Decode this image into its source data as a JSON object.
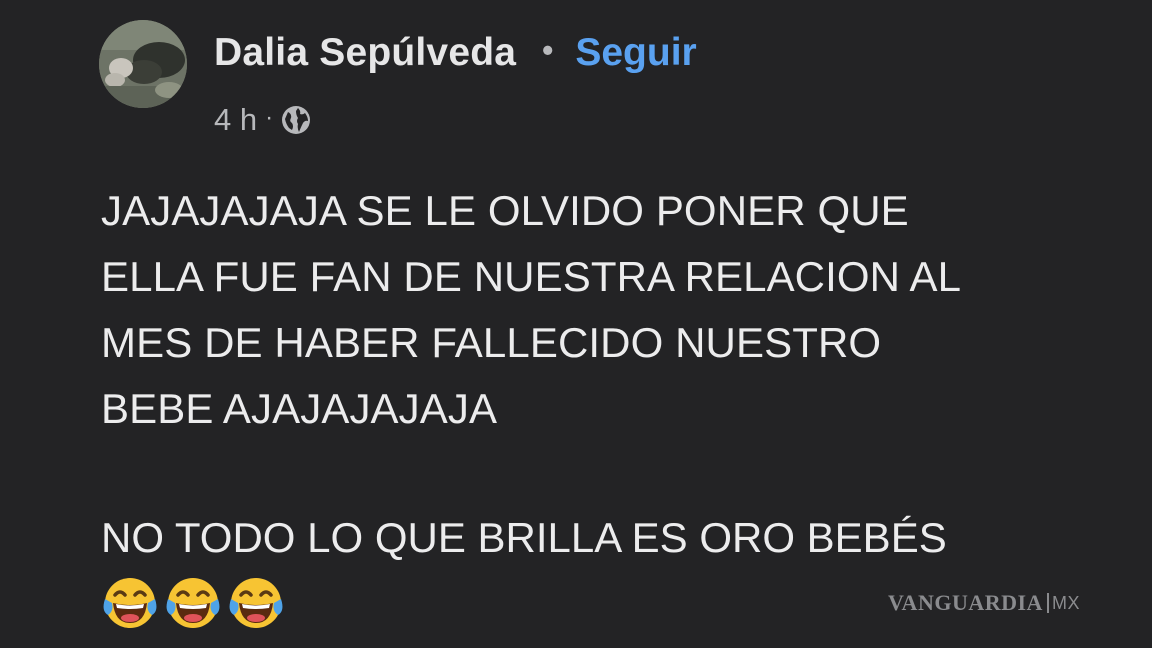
{
  "post": {
    "author": "Dalia Sepúlveda",
    "separator": "•",
    "follow_label": "Seguir",
    "timestamp": "4 h",
    "meta_separator": "·",
    "privacy_icon": "globe-icon",
    "body_text": "JAJAJAJAJA SE LE OLVIDO PONER QUE\nELLA FUE FAN DE NUESTRA RELACION AL\nMES DE HABER FALLECIDO NUESTRO\nBEBE AJAJAJAJAJA",
    "second_text": "NO TODO LO QUE BRILLA ES ORO BEBÉS",
    "emojis": [
      "face-with-tears-of-joy-icon",
      "face-with-tears-of-joy-icon",
      "face-with-tears-of-joy-icon"
    ]
  },
  "watermark": {
    "brand": "VANGUARDIA",
    "suffix": "MX"
  },
  "colors": {
    "background": "#232325",
    "text": "#ececed",
    "link": "#5aa1f0",
    "meta": "#b7b8bb",
    "watermark": "#8a8b8e"
  }
}
